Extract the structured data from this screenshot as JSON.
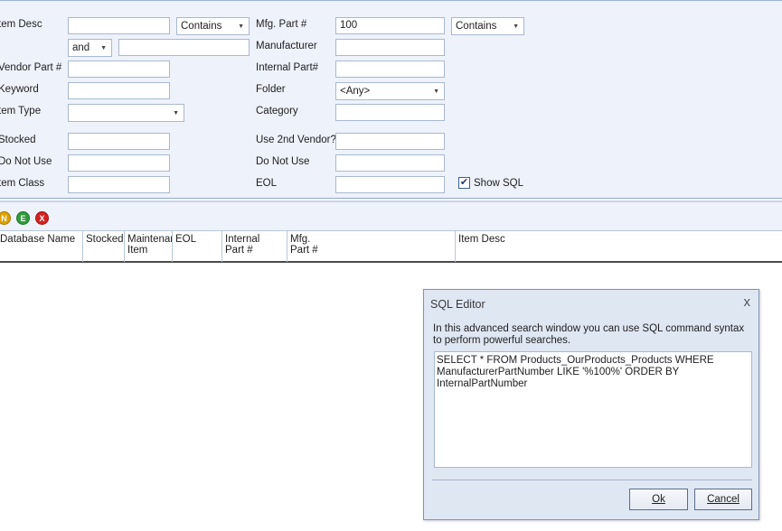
{
  "search": {
    "labels": {
      "item_desc": "tem Desc",
      "vendor_part": "Vendor Part #",
      "keyword": "Keyword",
      "item_type": "tem Type",
      "stocked": "Stocked",
      "do_not_use": "Do Not Use",
      "item_class": "tem Class",
      "mfg_part": "Mfg. Part #",
      "manufacturer": "Manufacturer",
      "internal_part": "Internal Part#",
      "folder": "Folder",
      "category": "Category",
      "use_2nd_vendor": "Use 2nd Vendor?",
      "do_not_use_2": "Do Not Use",
      "eol": "EOL"
    },
    "values": {
      "item_desc_op": "Contains",
      "item_desc_conj": "and",
      "mfg_part": "100",
      "mfg_part_op": "Contains",
      "folder": "<Any>"
    },
    "show_sql": {
      "label": "Show SQL",
      "checked": true,
      "mark": "✔"
    }
  },
  "actions": {
    "new": "N",
    "edit": "E",
    "delete": "X",
    "colors": {
      "new": "#e0a000",
      "edit": "#2e9a3a",
      "delete": "#d42020"
    }
  },
  "grid": {
    "columns": [
      "Database Name",
      "Stocked",
      "Maintenar\nItem",
      "EOL",
      "Internal\nPart #",
      "Mfg.\nPart #",
      "Item Desc"
    ]
  },
  "dialog": {
    "title": "SQL Editor",
    "close": "x",
    "description": "In this advanced search window you can use SQL command syntax to perform powerful searches.",
    "sql": "SELECT * FROM Products_OurProducts_Products WHERE\nManufacturerPartNumber  LIKE  '%100%'  ORDER BY\nInternalPartNumber",
    "ok": "Ok",
    "cancel": "Cancel"
  }
}
